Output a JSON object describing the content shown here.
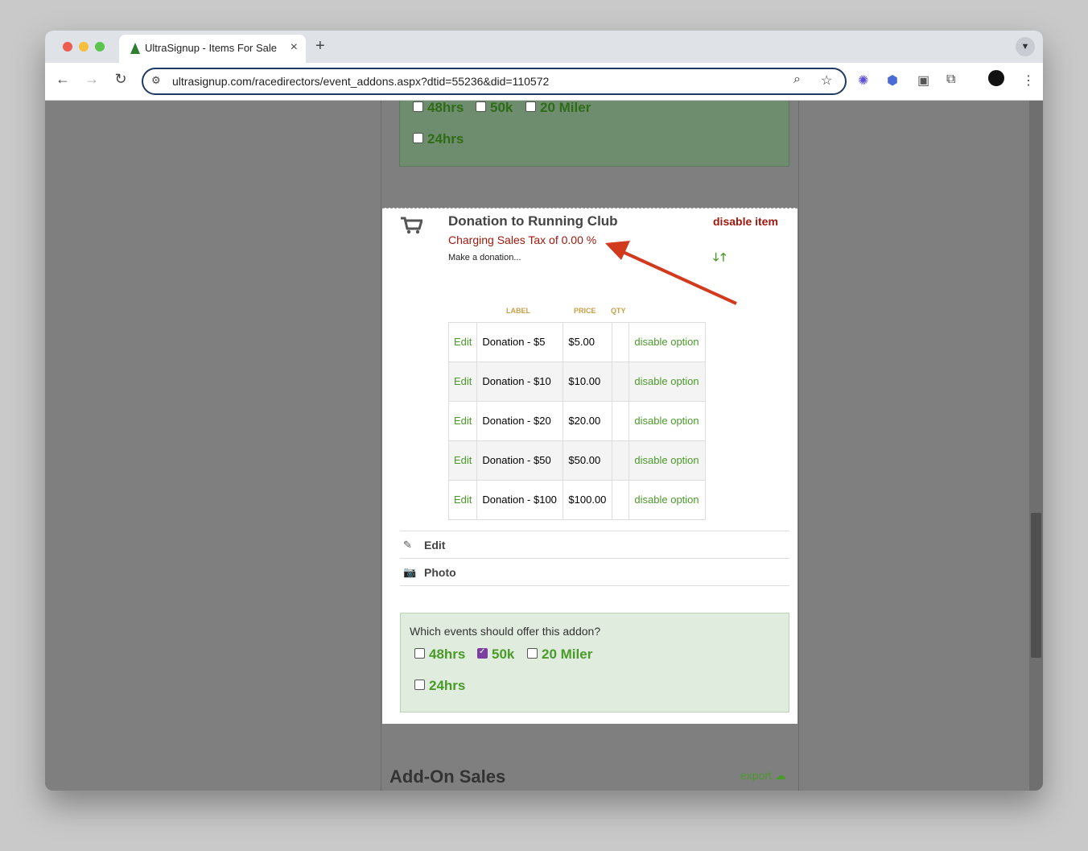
{
  "browser": {
    "tab_title": "UltraSignup - Items For Sale",
    "new_tab": "+",
    "url": "ultrasignup.com/racedirectors/event_addons.aspx?dtid=55236&did=110572"
  },
  "previous_addon_events": [
    "48hrs",
    "50k",
    "20 Miler",
    "24hrs"
  ],
  "item": {
    "title": "Donation to Running Club",
    "tax_text": "Charging Sales Tax of 0.00 %",
    "description": "Make a donation...",
    "disable_label": "disable item",
    "headers": {
      "label": "LABEL",
      "price": "PRICE",
      "qty": "QTY"
    },
    "options": [
      {
        "edit": "Edit",
        "label": "Donation - $5",
        "price": "$5.00",
        "qty": "",
        "disable": "disable option"
      },
      {
        "edit": "Edit",
        "label": "Donation - $10",
        "price": "$10.00",
        "qty": "",
        "disable": "disable option"
      },
      {
        "edit": "Edit",
        "label": "Donation - $20",
        "price": "$20.00",
        "qty": "",
        "disable": "disable option"
      },
      {
        "edit": "Edit",
        "label": "Donation - $50",
        "price": "$50.00",
        "qty": "",
        "disable": "disable option"
      },
      {
        "edit": "Edit",
        "label": "Donation - $100",
        "price": "$100.00",
        "qty": "",
        "disable": "disable option"
      }
    ],
    "edit_label": "Edit",
    "photo_label": "Photo"
  },
  "addon_events": {
    "question": "Which events should offer this addon?",
    "events": [
      {
        "label": "48hrs",
        "checked": false
      },
      {
        "label": "50k",
        "checked": true
      },
      {
        "label": "20 Miler",
        "checked": false
      },
      {
        "label": "24hrs",
        "checked": false
      }
    ]
  },
  "footer": {
    "section_title": "Add-On Sales",
    "export_label": "export"
  },
  "colors": {
    "accent_green": "#4a9a2a",
    "tax_red": "#a0180e",
    "annotation_arrow": "#d23a1e"
  }
}
